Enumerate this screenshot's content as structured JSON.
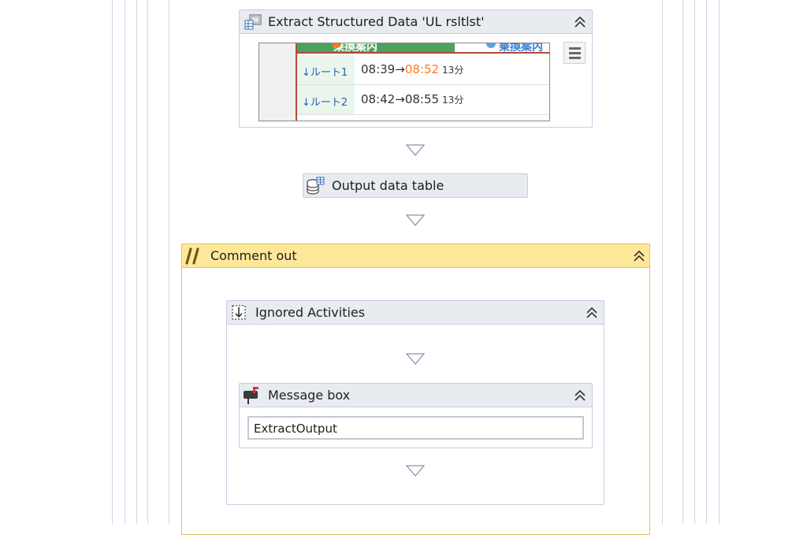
{
  "extract_card": {
    "title": "Extract Structured Data 'UL  rsltlst'",
    "preview": {
      "tab1": "乗換案内",
      "tab2": "乗換案内",
      "routes": [
        {
          "label": "↓ルート1",
          "depart": "08:39",
          "arrow": "→",
          "arrive": "08:52",
          "duration": "13分",
          "arrive_color": "#ff7a1a"
        },
        {
          "label": "↓ルート2",
          "depart": "08:42",
          "arrow": "→",
          "arrive": "08:55",
          "duration": "13分",
          "arrive_color": "#333333"
        }
      ]
    }
  },
  "output_card": {
    "title": "Output data table"
  },
  "comment_card": {
    "title": "Comment out"
  },
  "ignored_card": {
    "title": "Ignored Activities"
  },
  "message_card": {
    "title": "Message box",
    "input_value": "ExtractOutput"
  },
  "colors": {
    "header_bg": "#e8ebf0",
    "comment_bg": "#fde89a",
    "comment_border": "#e2c266",
    "border": "#c9cde0",
    "arrow_stroke": "#8a94ad"
  },
  "icons": {
    "extract": "table-extract-icon",
    "output": "database-table-icon",
    "comment": "comment-slashes-icon",
    "ignored": "ignored-activities-icon",
    "message": "message-box-icon",
    "collapse": "double-chevron-up-icon",
    "menu": "hamburger-menu-icon",
    "drop": "drop-target-triangle-icon"
  }
}
